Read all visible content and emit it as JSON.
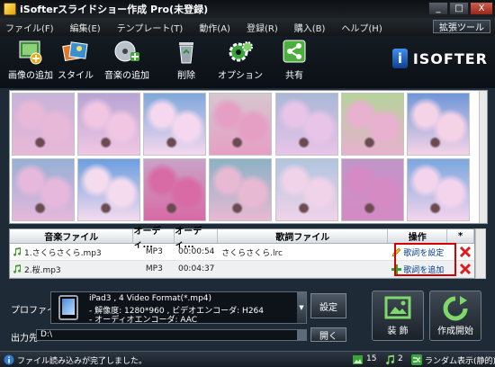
{
  "window": {
    "title": "iSofterスライドショー作成 Pro(未登録)",
    "minimize": "_",
    "maximize": "□",
    "close": "X"
  },
  "menu": [
    "ファイル(F)",
    "編集(E)",
    "テンプレート(T)",
    "動作(A)",
    "登録(R)",
    "購入(B)",
    "ヘルプ(H)"
  ],
  "extension_tools": "拡張ツール",
  "toolbar": {
    "add_image": "画像の追加",
    "style": "スタイル",
    "add_music": "音楽の追加",
    "delete": "削除",
    "options": "オプション",
    "share": "共有"
  },
  "logo": {
    "mark": "i",
    "text": "ISOFTER"
  },
  "gallery": {
    "thumbnails": [
      {
        "desc": "cherry-blossom-1",
        "sky": "#c7b3d9",
        "petal": "#e8b8d8"
      },
      {
        "desc": "cherry-blossom-2",
        "sky": "#b7a4d4",
        "petal": "#f0c6e3"
      },
      {
        "desc": "cherry-blossom-3",
        "sky": "#7fa7db",
        "petal": "#f5d8ef"
      },
      {
        "desc": "cherry-blossom-4",
        "sky": "#d6c7cf",
        "petal": "#e59fc4"
      },
      {
        "desc": "cherry-blossom-5",
        "sky": "#a9b8d6",
        "petal": "#e8c4e8"
      },
      {
        "desc": "cherry-blossom-6",
        "sky": "#b6d39a",
        "petal": "#e7b1cf"
      },
      {
        "desc": "cherry-blossom-7",
        "sky": "#6f97d9",
        "petal": "#f5d3e7"
      },
      {
        "desc": "cherry-blossom-8",
        "sky": "#95b0d4",
        "petal": "#e6b8dc"
      },
      {
        "desc": "cherry-blossom-9",
        "sky": "#6c9ee0",
        "petal": "#f4dbee"
      },
      {
        "desc": "cherry-blossom-10",
        "sky": "#c9a2c8",
        "petal": "#d86aa6"
      },
      {
        "desc": "cherry-blossom-11",
        "sky": "#8cb2c4",
        "petal": "#e8b9d3"
      },
      {
        "desc": "cherry-blossom-12",
        "sky": "#b1c5de",
        "petal": "#f0d3e9"
      },
      {
        "desc": "cherry-blossom-13",
        "sky": "#c096c8",
        "petal": "#d58ac4"
      },
      {
        "desc": "cherry-blossom-14",
        "sky": "#7aa7df",
        "petal": "#f3d4ec"
      }
    ]
  },
  "music": {
    "columns": [
      "音楽ファイル",
      "オーディ...",
      "オーディ...",
      "歌詞ファイル",
      "操作",
      "*"
    ],
    "rows": [
      {
        "file": "1.さくらさくら.mp3",
        "format": "MP3",
        "duration": "00:00:54",
        "lyrics": "さくらさくら.lrc",
        "action": "歌詞を設定"
      },
      {
        "file": "2.桜.mp3",
        "format": "MP3",
        "duration": "00:04:37",
        "lyrics": "",
        "action": "歌詞を追加"
      }
    ]
  },
  "output": {
    "profile_label": "プロファイル:",
    "profile_line1": "iPad3 , 4 Video Format(*.mp4)",
    "profile_line2": "- 解像度: 1280*960 , ビデオエンコーダ: H264",
    "profile_line3": "- オーディオエンコーダ: AAC",
    "settings_button": "設定",
    "destination_label": "出力先:",
    "destination_value": "D:\\",
    "open_button": "開く",
    "decorate_button": "装 飾",
    "start_button": "作成開始"
  },
  "status": {
    "message": "ファイル読み込みが完了しました。",
    "image_count": "15",
    "music_count": "2",
    "random_display": "ランダム表示(静的)"
  },
  "colors": {
    "accent_red": "#d20000",
    "background": "#1e2a36"
  }
}
